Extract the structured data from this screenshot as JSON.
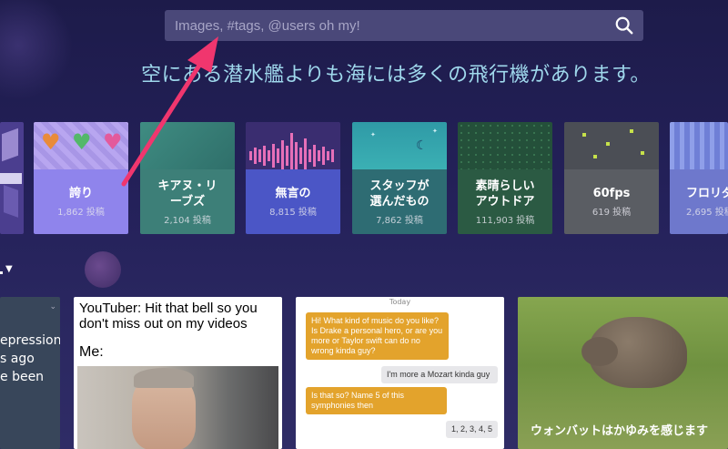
{
  "search": {
    "placeholder": "Images, #tags, @users oh my!"
  },
  "tagline": "空にある潜水艦よりも海には多くの飛行機があります。",
  "tags": [
    {
      "name": "",
      "count": ""
    },
    {
      "name": "誇り",
      "count": "1,862 投稿"
    },
    {
      "name": "キアヌ・リ\nーブズ",
      "count": "2,104 投稿"
    },
    {
      "name": "無言の",
      "count": "8,815 投稿"
    },
    {
      "name": "スタッフが\n選んだもの",
      "count": "7,862 投稿"
    },
    {
      "name": "素晴らしい\nアウトドア",
      "count": "111,903 投稿"
    },
    {
      "name": "60fps",
      "count": "619 投稿"
    },
    {
      "name": "フロリダ",
      "count": "2,695 投稿"
    }
  ],
  "cards": {
    "left_text": [
      "epression",
      "s ago",
      "e been"
    ],
    "meme": {
      "line1": "YouTuber: Hit that bell so you don't miss out on my videos",
      "line2": "Me:"
    },
    "chat": {
      "header": "Today",
      "messages": [
        "Hi! What kind of music do you like? Is Drake a personal hero, or are you more or Taylor swift can do no wrong kinda guy?",
        "I'm more a Mozart kinda guy",
        "Is that so? Name 5 of this symphonies then",
        "1, 2, 3, 4, 5"
      ]
    },
    "wombat": {
      "caption": "ウォンバットはかゆみを感じます"
    }
  },
  "colors": {
    "accent_arrow": "#f0366e",
    "tagline": "#9fd8ec",
    "search_bg": "#4a4879"
  }
}
